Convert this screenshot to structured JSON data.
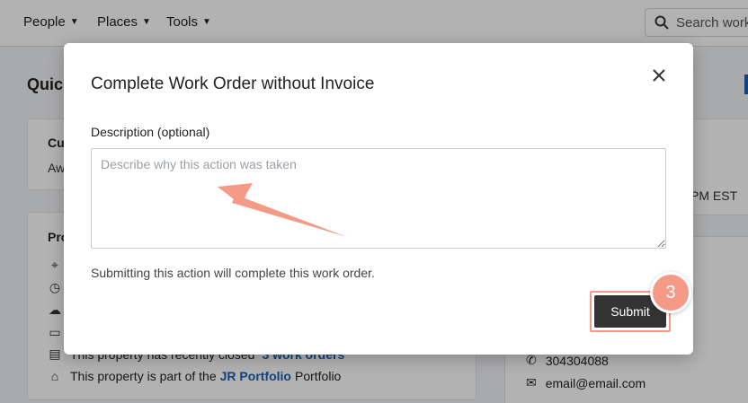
{
  "nav": {
    "items": [
      {
        "label": "People"
      },
      {
        "label": "Places"
      },
      {
        "label": "Tools"
      }
    ],
    "search_placeholder": "Search work"
  },
  "background": {
    "page_title": "Quick",
    "status_card": {
      "label": "Cu",
      "value": "Aw"
    },
    "property_card": {
      "label": "Pro",
      "closed_text": "This property has recently closed",
      "closed_link": "3 work orders",
      "portfolio_prefix": "This property is part of the",
      "portfolio_link": "JR Portfolio",
      "portfolio_suffix": "Portfolio"
    },
    "right_panel": {
      "time_fragment": "PM EST",
      "phone": "304304088",
      "email": "email@email.com"
    }
  },
  "modal": {
    "title": "Complete Work Order without Invoice",
    "description_label": "Description (optional)",
    "description_placeholder": "Describe why this action was taken",
    "description_value": "",
    "info_text": "Submitting this action will complete this work order.",
    "submit_label": "Submit"
  },
  "annotation": {
    "step_number": "3",
    "accent_color": "#f49a86"
  },
  "icons": {
    "close": "close-icon",
    "search": "search-icon",
    "caret": "chevron-down-icon"
  }
}
